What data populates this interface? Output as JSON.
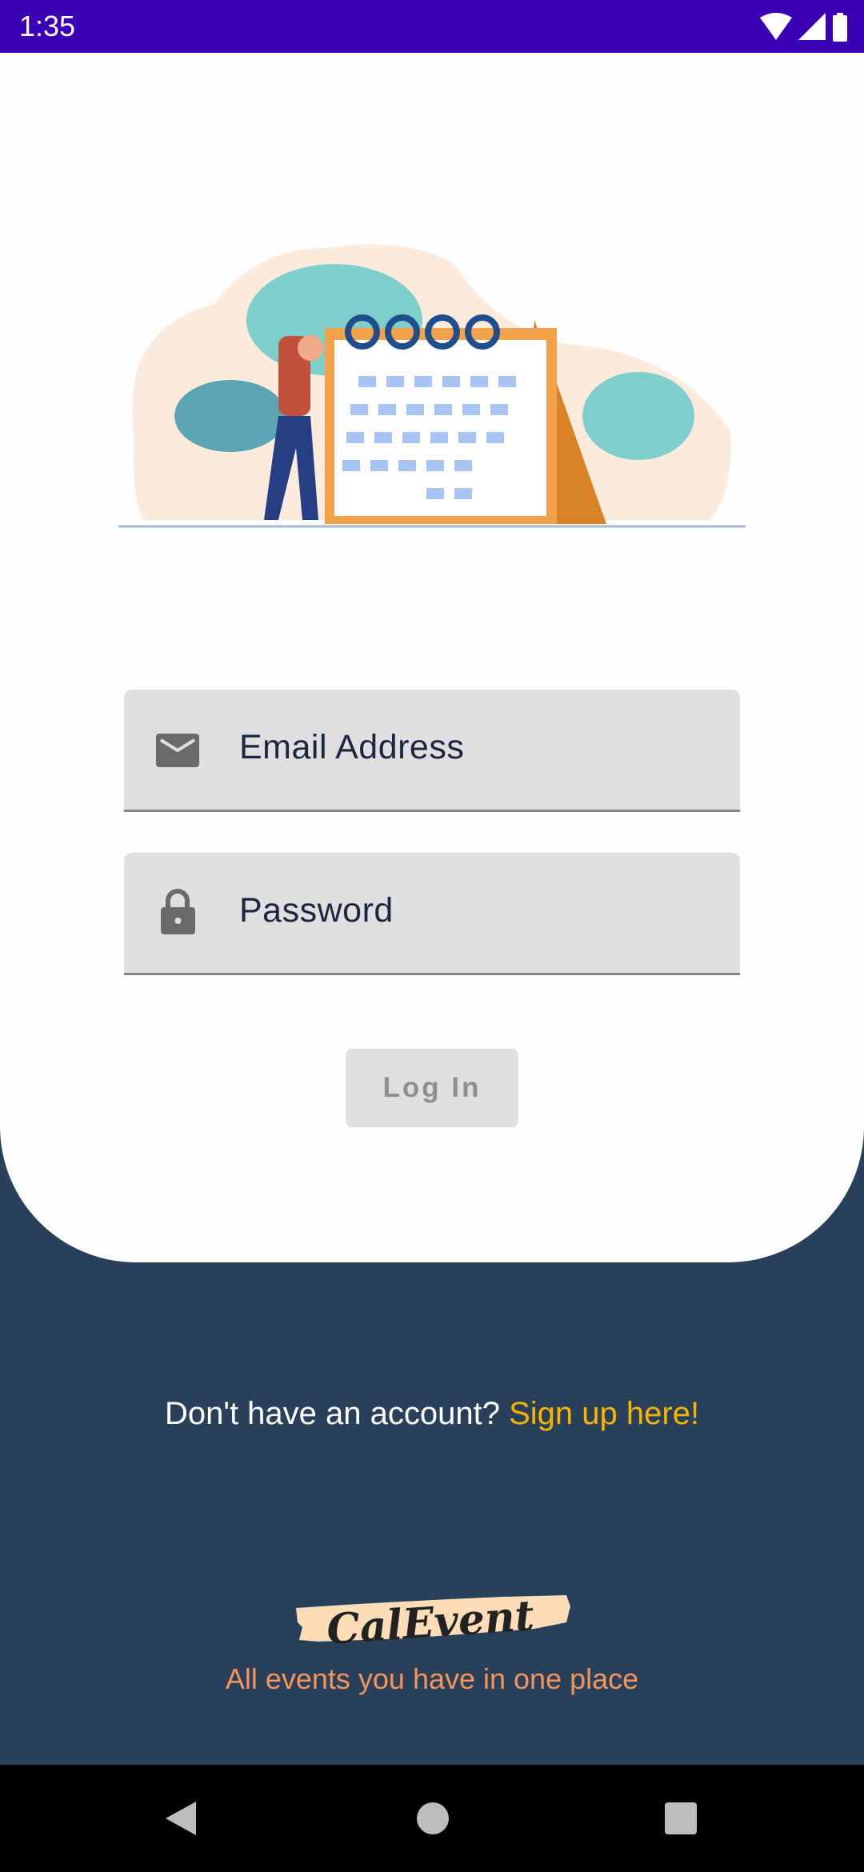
{
  "status_bar": {
    "time": "1:35",
    "icons": [
      "wifi-icon",
      "signal-icon",
      "battery-icon"
    ]
  },
  "login": {
    "email_placeholder": "Email Address",
    "password_placeholder": "Password",
    "login_label": "Log In"
  },
  "signup": {
    "prompt": "Don't have an account?",
    "link": "Sign up here!"
  },
  "brand": {
    "logo_text": "CalEvent",
    "tagline": "All events you have in one place"
  },
  "colors": {
    "status_bar": "#3A00B3",
    "background": "#284059",
    "link": "#F8B400",
    "tagline": "#F4945C"
  },
  "nav_bar": {
    "icons": [
      "back-icon",
      "home-icon",
      "recents-icon"
    ]
  }
}
